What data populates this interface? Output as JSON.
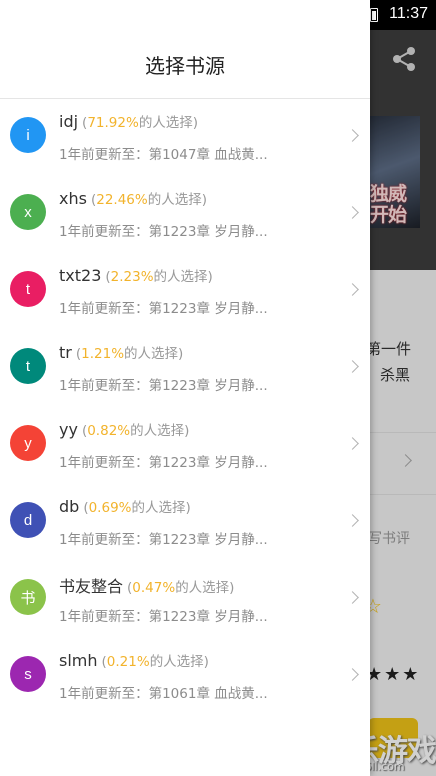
{
  "status_bar": {
    "time": "11:37"
  },
  "background": {
    "cover_lines": [
      "独威",
      "开始"
    ],
    "snippet_line1": "第一件",
    "snippet_line2": "杀黑",
    "review_label": "写书评",
    "partial_paren": ")",
    "stars": "★★★",
    "outline_star": "☆",
    "watermark": "乐乐游戏",
    "watermark_url": "www.6ll.com"
  },
  "dialog": {
    "title": "选择书源",
    "sources": [
      {
        "avatar_letter": "i",
        "avatar_color": "#2196f3",
        "name": "idj",
        "percent": "71.92%",
        "select_suffix": "的人选择)",
        "update_text": "1年前更新至：第1047章 血战黄..."
      },
      {
        "avatar_letter": "x",
        "avatar_color": "#4caf50",
        "name": "xhs",
        "percent": "22.46%",
        "select_suffix": "的人选择)",
        "update_text": "1年前更新至：第1223章 岁月静..."
      },
      {
        "avatar_letter": "t",
        "avatar_color": "#e91e63",
        "name": "txt23",
        "percent": "2.23%",
        "select_suffix": "的人选择)",
        "update_text": "1年前更新至：第1223章 岁月静..."
      },
      {
        "avatar_letter": "t",
        "avatar_color": "#00897b",
        "name": "tr",
        "percent": "1.21%",
        "select_suffix": "的人选择)",
        "update_text": "1年前更新至：第1223章 岁月静..."
      },
      {
        "avatar_letter": "y",
        "avatar_color": "#f44336",
        "name": "yy",
        "percent": "0.82%",
        "select_suffix": "的人选择)",
        "update_text": "1年前更新至：第1223章 岁月静..."
      },
      {
        "avatar_letter": "d",
        "avatar_color": "#3f51b5",
        "name": "db",
        "percent": "0.69%",
        "select_suffix": "的人选择)",
        "update_text": "1年前更新至：第1223章 岁月静..."
      },
      {
        "avatar_letter": "书",
        "avatar_color": "#8bc34a",
        "name": "书友整合",
        "percent": "0.47%",
        "select_suffix": "的人选择)",
        "update_text": "1年前更新至：第1223章 岁月静..."
      },
      {
        "avatar_letter": "s",
        "avatar_color": "#9c27b0",
        "name": "slmh",
        "percent": "0.21%",
        "select_suffix": "的人选择)",
        "update_text": "1年前更新至：第1061章 血战黄..."
      }
    ]
  }
}
